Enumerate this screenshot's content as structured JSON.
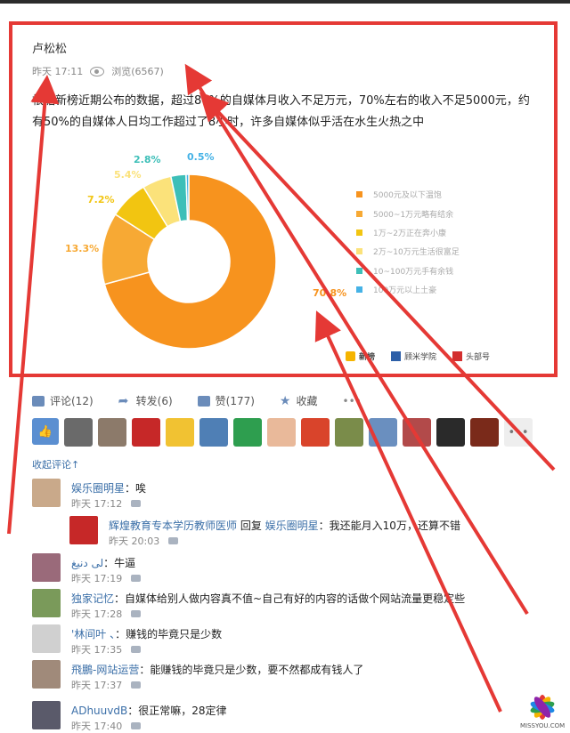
{
  "post": {
    "author": "卢松松",
    "time": "昨天 17:11",
    "views": "浏览(6567)",
    "text": "根据新榜近期公布的数据，超过80%的自媒体月收入不足万元，70%左右的收入不足5000元，约有50%的自媒体人日均工作超过了8小时，许多自媒体似乎活在水生火热之中"
  },
  "chart_data": {
    "type": "pie",
    "values": [
      70.8,
      13.3,
      7.2,
      5.4,
      2.8,
      0.5
    ],
    "value_labels": [
      "70.8%",
      "13.3%",
      "7.2%",
      "5.4%",
      "2.8%",
      "0.5%"
    ],
    "categories": [
      "5000元及以下温饱",
      "5000~1万元略有结余",
      "1万~2万正在奔小康",
      "2万~10万元生活很富足",
      "10~100万元手有余钱",
      "100万元以上土豪"
    ],
    "colors": [
      "#f7931e",
      "#f7a934",
      "#f2c511",
      "#fbe27a",
      "#3dbfb8",
      "#45b2e6"
    ],
    "legend_position": "right"
  },
  "brands": [
    "新榜",
    "顾米学院",
    "头部号"
  ],
  "actions": {
    "comment": "评论(12)",
    "repost": "转发(6)",
    "like": "赞(177)",
    "favorite": "收藏",
    "more": "•••"
  },
  "liker_colors": [
    "#6a6a6a",
    "#8c7a6a",
    "#c62828",
    "#f1c232",
    "#4f7fb5",
    "#2e9e4f",
    "#e9b99a",
    "#d9442b",
    "#7a8c4a",
    "#6a8fbf",
    "#b24a4a",
    "#2a2a2a",
    "#7a2a1a"
  ],
  "liker_more": "•••",
  "collapse_label": "收起评论↑",
  "comments": [
    {
      "name": "娱乐圈明星",
      "text": "：唉",
      "time": "昨天 17:12",
      "color": "#c9a98a"
    },
    {
      "name": "辉煌教育专本学历教师医师",
      "reply": "回复",
      "target": "娱乐圈明星",
      "text": "：我还能月入10万，还算不错",
      "time": "昨天 20:03",
      "color": "#c62828"
    },
    {
      "name": "لى دنيغ",
      "text": "：牛逼",
      "time": "昨天 17:19",
      "color": "#9a6a7a"
    },
    {
      "name": "独家记忆",
      "text": "：自媒体给别人做内容真不值~自己有好的内容的话做个网站流量更稳定些",
      "time": "昨天 17:28",
      "color": "#7a9a5a"
    },
    {
      "name": "'林间叶 、",
      "text": "：赚钱的毕竟只是少数",
      "time": "昨天 17:35",
      "color": "#d0d0d0"
    },
    {
      "name": "飛鵬-网站运营",
      "text": "：能赚钱的毕竟只是少数，要不然都成有钱人了",
      "time": "昨天 17:37",
      "color": "#a08a7a"
    },
    {
      "name": "ADhuuvdB",
      "text": "：很正常嘛，28定律",
      "time": "昨天 17:40",
      "color": "#5a5a6a"
    }
  ],
  "watermark": "MISSYOU.COM"
}
